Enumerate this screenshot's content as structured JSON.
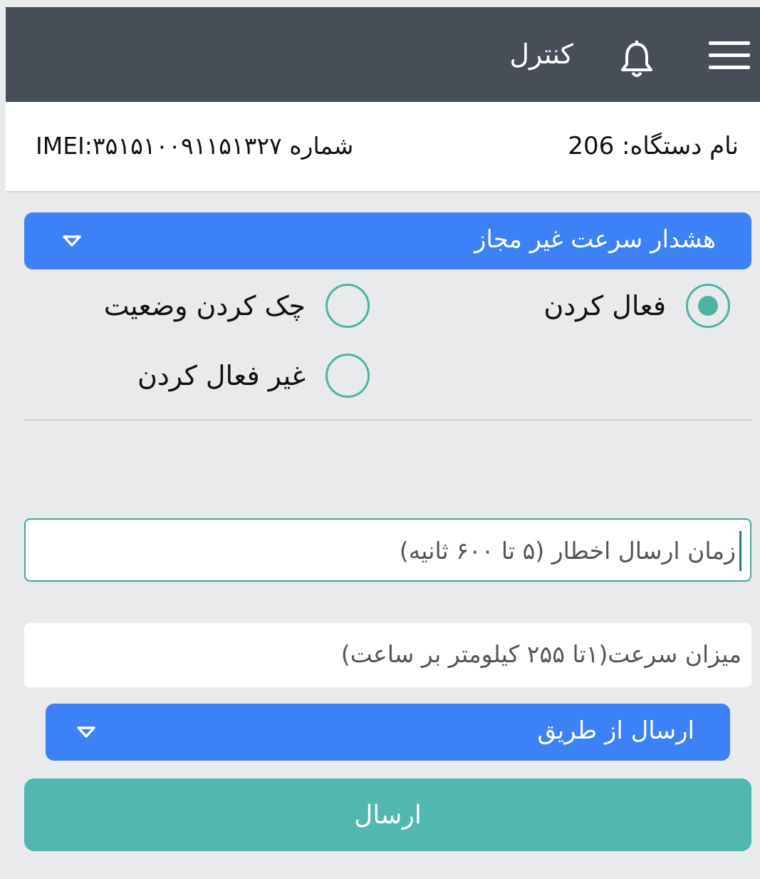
{
  "header": {
    "title": "کنترل",
    "icons": [
      "menu-icon",
      "bell-icon"
    ]
  },
  "device": {
    "name_label": "نام دستگاه: 206",
    "imei_label": "شماره IMEI:۳۵۱۵۱۰۰۹۱۱۵۱۳۲۷"
  },
  "alert_type": {
    "selected": "هشدار سرعت غیر مجاز"
  },
  "actions": {
    "options": [
      "فعال کردن",
      "چک کردن وضعیت",
      "غیر فعال کردن"
    ],
    "selected": "فعال کردن"
  },
  "inputs": {
    "notify_time_placeholder": "زمان ارسال اخطار (۵ تا ۶۰۰ ثانیه)",
    "speed_placeholder": "میزان سرعت(۱تا ۲۵۵ کیلومتر بر ساعت)"
  },
  "send_via": {
    "selected": "ارسال از طریق"
  },
  "submit": {
    "label": "ارسال"
  },
  "colors": {
    "header": "#474e57",
    "accent_blue": "#3c82f6",
    "teal": "#50b8ae"
  }
}
